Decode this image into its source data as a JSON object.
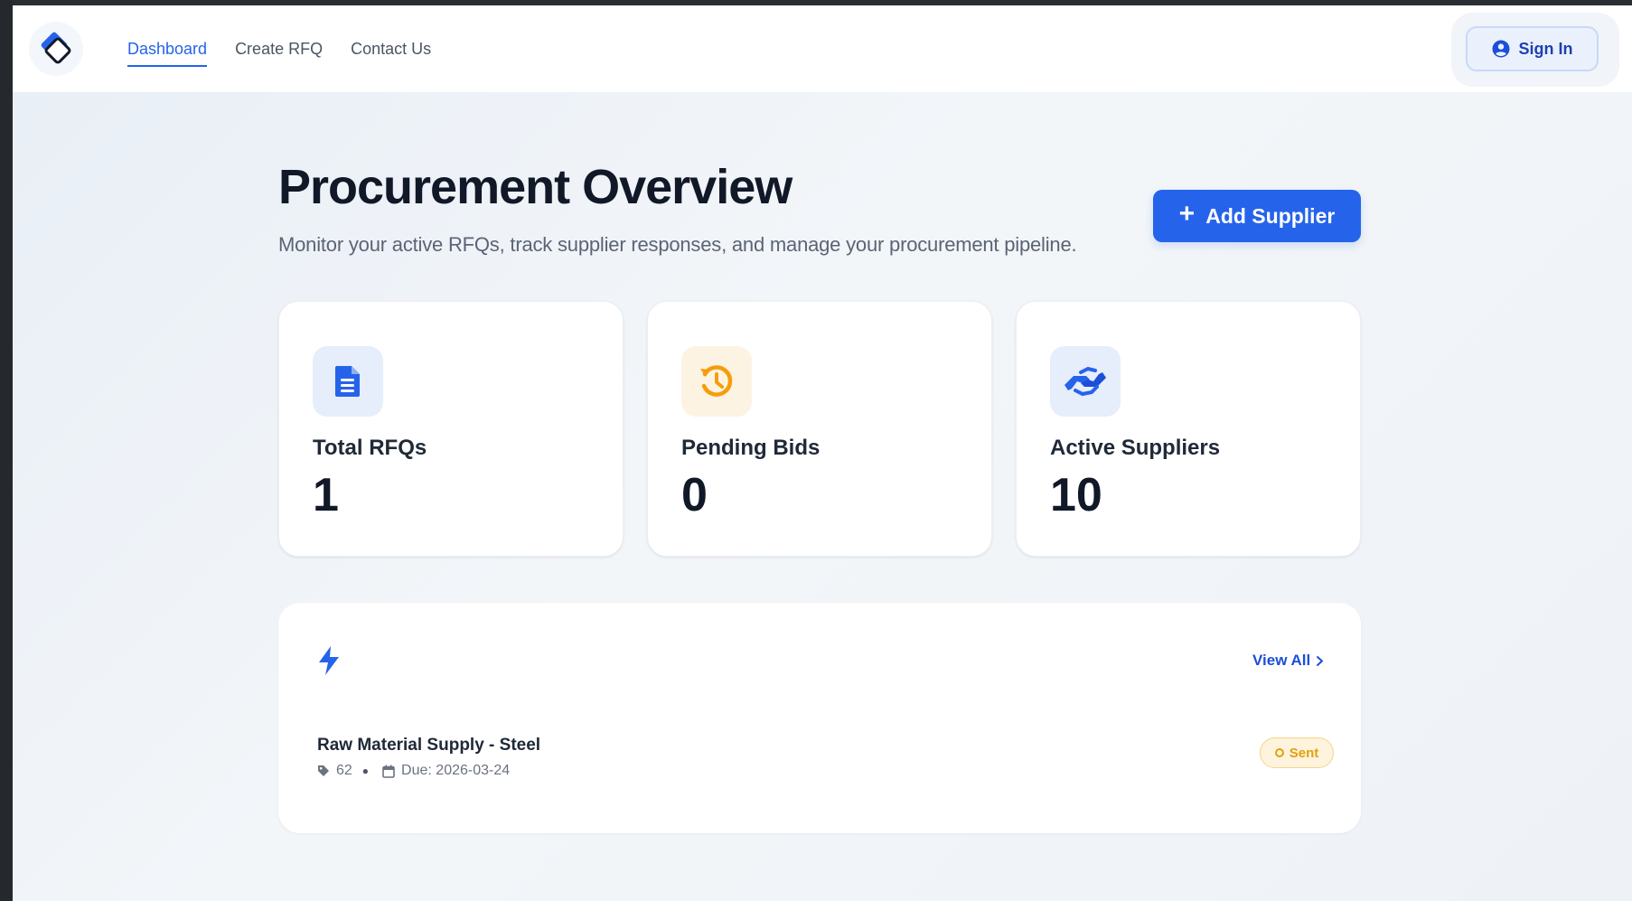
{
  "nav": {
    "links": [
      {
        "label": "Dashboard",
        "active": true
      },
      {
        "label": "Create RFQ",
        "active": false
      },
      {
        "label": "Contact Us",
        "active": false
      }
    ],
    "signin_label": "Sign In"
  },
  "header": {
    "title": "Procurement Overview",
    "subtitle": "Monitor your active RFQs, track supplier responses, and manage your procurement pipeline.",
    "add_supplier_label": "Add Supplier"
  },
  "stats": [
    {
      "label": "Total RFQs",
      "value": "1",
      "icon": "document-icon",
      "color": "#2563eb",
      "tile": "#e6edfb"
    },
    {
      "label": "Pending Bids",
      "value": "0",
      "icon": "history-icon",
      "color": "#f59e0b",
      "tile": "#fdf3e2"
    },
    {
      "label": "Active Suppliers",
      "value": "10",
      "icon": "handshake-icon",
      "color": "#2563eb",
      "tile": "#e6edfb"
    }
  ],
  "activity": {
    "icon": "bolt-icon",
    "view_all_label": "View All",
    "items": [
      {
        "title": "Raw Material Supply - Steel",
        "quantity": "62",
        "due": "Due: 2026-03-24",
        "status": "Sent"
      }
    ]
  },
  "colors": {
    "accent": "#2563eb",
    "status_sent": "#e0a10e"
  }
}
